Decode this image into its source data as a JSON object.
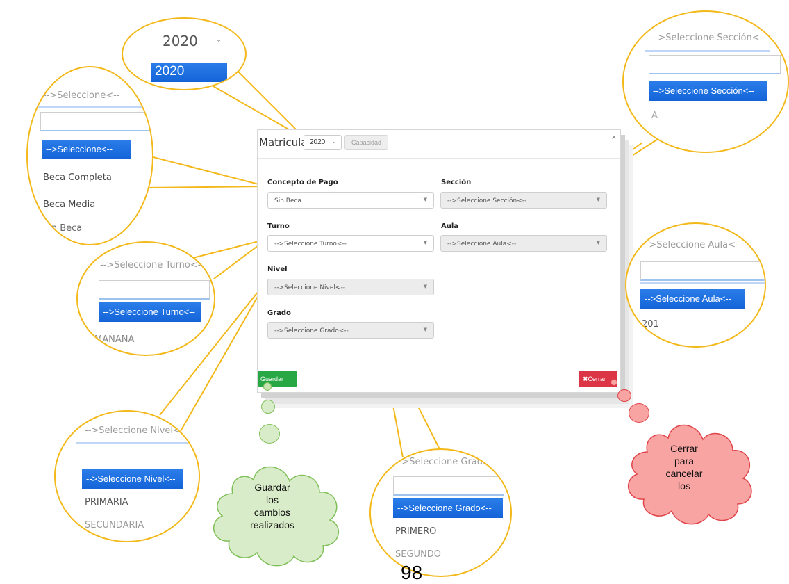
{
  "modal": {
    "title": "Matricula",
    "year_value": "2020",
    "capacity_label": "Capacidad",
    "close_symbol": "×",
    "fields": {
      "concepto_label": "Concepto de Pago",
      "concepto_value": "Sin Beca",
      "seccion_label": "Sección",
      "seccion_placeholder": "-->Seleccione Sección<--",
      "turno_label": "Turno",
      "turno_placeholder": "-->Seleccione Turno<--",
      "aula_label": "Aula",
      "aula_placeholder": "-->Seleccione Aula<--",
      "nivel_label": "Nivel",
      "nivel_placeholder": "-->Seleccione Nivel<--",
      "grado_label": "Grado",
      "grado_placeholder": "-->Seleccione Grado<--"
    },
    "save_label": "Guardar",
    "close_label": "Cerrar"
  },
  "callouts": {
    "year": {
      "value": "2020",
      "option": "2020"
    },
    "concepto": {
      "header": "-->Seleccione<--",
      "selected": "-->Seleccione<--",
      "options": [
        "Beca Completa",
        "Beca Media",
        "Sin Beca"
      ]
    },
    "turno": {
      "header": "-->Seleccione Turno<--",
      "selected": "-->Seleccione Turno<--",
      "options": [
        "MAÑANA"
      ]
    },
    "nivel": {
      "header": "-->Seleccione Nivel<--",
      "selected": "-->Seleccione Nivel<--",
      "options": [
        "PRIMARIA",
        "SECUNDARIA"
      ]
    },
    "grado": {
      "header": "-->Seleccione Grado<--",
      "selected": "-->Seleccione Grado<--",
      "options": [
        "PRIMERO",
        "SEGUNDO"
      ]
    },
    "seccion": {
      "header": "-->Seleccione Sección<--",
      "selected": "-->Seleccione Sección<--",
      "options": [
        "A"
      ]
    },
    "aula": {
      "header": "-->Seleccione Aula<--",
      "selected": "-->Seleccione Aula<--",
      "options": [
        "201"
      ]
    }
  },
  "clouds": {
    "save_note": [
      "Guardar",
      "los",
      "cambios",
      "realizados"
    ],
    "close_note": [
      "Cerrar",
      "para",
      "cancelar",
      "los"
    ]
  },
  "page_number": "98",
  "colors": {
    "accent_yellow": "#f3b81a",
    "select_blue": "#1a73e8",
    "save_green": "#28a745",
    "close_red": "#dc3545",
    "cloud_green": "#d9ecc9",
    "cloud_red": "#f7a4a2"
  }
}
